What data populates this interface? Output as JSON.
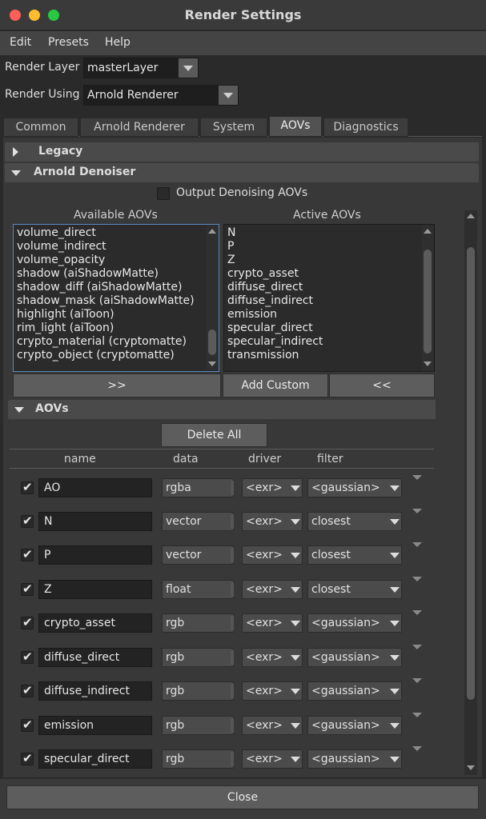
{
  "window": {
    "title": "Render Settings"
  },
  "menu": [
    "Edit",
    "Presets",
    "Help"
  ],
  "render_layer": {
    "label": "Render Layer",
    "value": "masterLayer"
  },
  "render_using": {
    "label": "Render Using",
    "value": "Arnold Renderer"
  },
  "tabs": [
    {
      "label": "Common",
      "active": false
    },
    {
      "label": "Arnold Renderer",
      "active": false
    },
    {
      "label": "System",
      "active": false
    },
    {
      "label": "AOVs",
      "active": true
    },
    {
      "label": "Diagnostics",
      "active": false
    }
  ],
  "sections": {
    "legacy": "Legacy",
    "denoiser": "Arnold Denoiser",
    "aovs": "AOVs"
  },
  "output_denoising": {
    "label": "Output Denoising AOVs",
    "checked": false
  },
  "available": {
    "header": "Available AOVs",
    "items": [
      "volume_direct",
      "volume_indirect",
      "volume_opacity",
      "shadow (aiShadowMatte)",
      "shadow_diff (aiShadowMatte)",
      "shadow_mask (aiShadowMatte)",
      "highlight (aiToon)",
      "rim_light (aiToon)",
      "crypto_material (cryptomatte)",
      "crypto_object (cryptomatte)"
    ]
  },
  "active": {
    "header": "Active AOVs",
    "items": [
      "N",
      "P",
      "Z",
      "crypto_asset",
      "diffuse_direct",
      "diffuse_indirect",
      "emission",
      "specular_direct",
      "specular_indirect",
      "transmission"
    ]
  },
  "buttons": {
    "add": ">>",
    "add_custom": "Add Custom",
    "remove": "<<",
    "delete_all": "Delete All",
    "close": "Close"
  },
  "columns": {
    "name": "name",
    "data": "data",
    "driver": "driver",
    "filter": "filter"
  },
  "aov_rows": [
    {
      "enabled": true,
      "name": "AO",
      "data": "rgba",
      "driver": "<exr>",
      "filter": "<gaussian>"
    },
    {
      "enabled": true,
      "name": "N",
      "data": "vector",
      "driver": "<exr>",
      "filter": "closest"
    },
    {
      "enabled": true,
      "name": "P",
      "data": "vector",
      "driver": "<exr>",
      "filter": "closest"
    },
    {
      "enabled": true,
      "name": "Z",
      "data": "float",
      "driver": "<exr>",
      "filter": "closest"
    },
    {
      "enabled": true,
      "name": "crypto_asset",
      "data": "rgb",
      "driver": "<exr>",
      "filter": "<gaussian>"
    },
    {
      "enabled": true,
      "name": "diffuse_direct",
      "data": "rgb",
      "driver": "<exr>",
      "filter": "<gaussian>"
    },
    {
      "enabled": true,
      "name": "diffuse_indirect",
      "data": "rgb",
      "driver": "<exr>",
      "filter": "<gaussian>"
    },
    {
      "enabled": true,
      "name": "emission",
      "data": "rgb",
      "driver": "<exr>",
      "filter": "<gaussian>"
    },
    {
      "enabled": true,
      "name": "specular_direct",
      "data": "rgb",
      "driver": "<exr>",
      "filter": "<gaussian>"
    }
  ]
}
